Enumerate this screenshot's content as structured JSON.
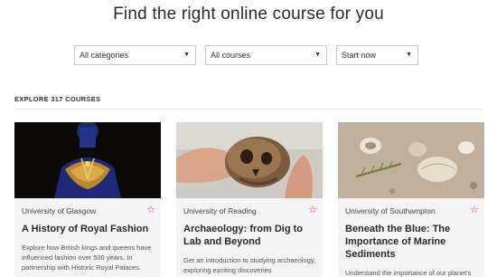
{
  "page": {
    "heading": "Find the right online course for you"
  },
  "filters": {
    "category": "All categories",
    "courses": "All courses",
    "start": "Start now"
  },
  "explore_label": "EXPLORE 317 COURSES",
  "courses": [
    {
      "university": "University of Glasgow",
      "title": "A History of Royal Fashion",
      "description": "Explore how British kings and queens have influenced fashion over 500 years. In partnership with Historic Royal Palaces."
    },
    {
      "university": "University of Reading",
      "title": "Archaeology: from Dig to Lab and Beyond",
      "description": "Get an introduction to studying archaeology, exploring exciting discoveries"
    },
    {
      "university": "University of Southampton",
      "title": "Beneath the Blue: The Importance of Marine Sediments",
      "description": "Understand the importance of our planet's"
    }
  ],
  "colors": {
    "star": "#d1169b",
    "card_bg": "#f4f4f4"
  },
  "icons": {
    "select_arrow": "triangle-down-icon",
    "favorite": "star-outline-icon"
  }
}
